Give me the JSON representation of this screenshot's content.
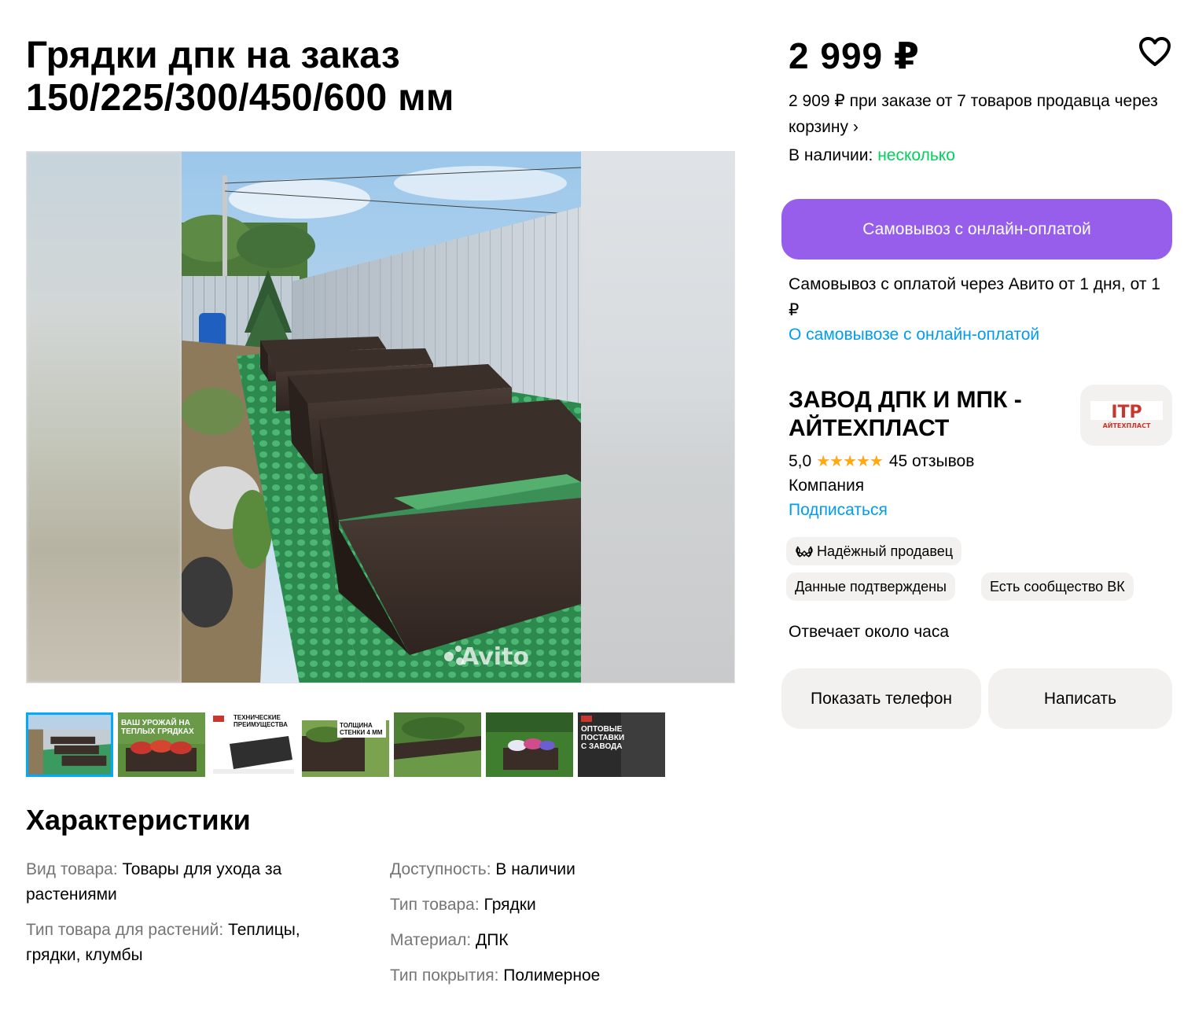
{
  "listing": {
    "title_line1": "Грядки дпк на заказ",
    "title_line2": "150/225/300/450/600 мм",
    "price": "2 999 ₽",
    "bulk_price_text": "2 909 ₽ при заказе от 7 товаров продавца через корзину ›",
    "stock_label": "В наличии: ",
    "stock_value": "несколько",
    "image_watermark": "Avito"
  },
  "pickup": {
    "button_label": "Самовывоз с онлайн-оплатой",
    "info_text": "Самовывоз с оплатой через Авито от 1 дня, от 1 ₽",
    "link_label": "О самовывозе с онлайн-оплатой"
  },
  "seller": {
    "name": "ЗАВОД ДПК И МПК - АЙТЕХПЛАСТ",
    "logo_text": "ITP",
    "logo_subtext": "АЙТЕХПЛАСТ",
    "rating": "5,0",
    "stars": "★★★★★",
    "reviews": "45 отзывов",
    "type": "Компания",
    "subscribe_label": "Подписаться",
    "badges": [
      "Надёжный продавец",
      "Данные подтверждены",
      "Есть сообщество ВК"
    ],
    "response_time": "Отвечает около часа",
    "show_phone_label": "Показать телефон",
    "write_label": "Написать"
  },
  "thumbnails": [
    {
      "caption": ""
    },
    {
      "caption": "ВАШ УРОЖАЙ НА ТЕПЛЫХ ГРЯДКАХ"
    },
    {
      "caption": "ТЕХНИЧЕСКИЕ ПРЕИМУЩЕСТВА"
    },
    {
      "caption": "ТОЛЩИНА СТЕНКИ 4 мм"
    },
    {
      "caption": ""
    },
    {
      "caption": ""
    },
    {
      "caption": "ОПТОВЫЕ ПОСТАВКИ С ЗАВОДА"
    }
  ],
  "characteristics": {
    "title": "Характеристики",
    "left": [
      {
        "key": "Вид товара: ",
        "value": "Товары для ухода за растениями"
      },
      {
        "key": "Тип товара для растений: ",
        "value": "Теплицы, грядки, клумбы"
      }
    ],
    "right": [
      {
        "key": "Доступность: ",
        "value": "В наличии"
      },
      {
        "key": "Тип товара: ",
        "value": "Грядки"
      },
      {
        "key": "Материал: ",
        "value": "ДПК"
      },
      {
        "key": "Тип покрытия: ",
        "value": "Полимерное"
      }
    ]
  },
  "colors": {
    "accent_purple": "#965eeb",
    "link_blue": "#009cf0",
    "stock_green": "#02d15c",
    "star_orange": "#ffa913",
    "thumb_active_border": "#00aaff"
  }
}
